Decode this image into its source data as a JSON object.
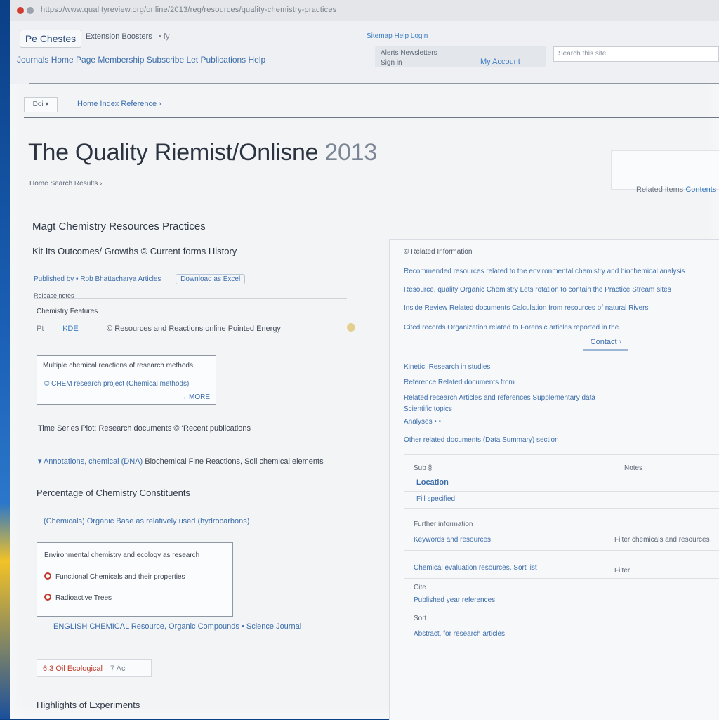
{
  "browser": {
    "url_text": "https://www.qualityreview.org/online/2013/reg/resources/quality-chemistry-practices"
  },
  "header": {
    "logo": "Pe Chestes",
    "link_a": "Extension Boosters",
    "link_b": "• fy",
    "top_right": "Sitemap Help Login",
    "nav": "Journals Home Page Membership  Subscribe  Let Publications Help",
    "mid_1": "Alerts Newsletters",
    "mid_2": "Sign in",
    "mid_3": "My Account",
    "search_placeholder": "Search this site"
  },
  "breadcrumb": {
    "box": "Doi ▾",
    "link": "Home Index Reference ›"
  },
  "page": {
    "title": "The Quality Riemist/Onlisne",
    "title_year": "2013",
    "subtitle": "Home Search Results ›"
  },
  "right_card": {
    "text": "Related items",
    "blue": "Contents"
  },
  "left": {
    "h2": "Magt Chemistry Resources Practices",
    "h3": "Kit Its Outcomes/ Growths  © Current forms History",
    "meta": "Published by • Rob Bhattacharya Articles",
    "meta_red": "Articles",
    "meta_pill": "Download as Excel",
    "small_label": "Release notes",
    "small_label2": "Chemistry Features",
    "row_tag": "Pt",
    "row_blue": "KDE",
    "row_text": "©  Resources and Reactions online Pointed Energy",
    "box_a": {
      "t1": "Multiple chemical reactions of research methods",
      "t2": "© CHEM  research project (Chemical methods)",
      "t3": "→ MORE"
    },
    "para_1": "Time Series Plot: Research documents © ‘Recent publications",
    "para_2_blue": "▾ Annotations, chemical (DNA)",
    "para_2": " Biochemical Fine Reactions, Soil chemical elements",
    "h3b": "Percentage of Chemistry Constituents",
    "link": "(Chemicals)  Organic Base as relatively used (hydrocarbons)",
    "box_b": {
      "t1": "Environmental chemistry and ecology as research",
      "t2": "Functional Chemicals and their properties",
      "t3": "Radioactive Trees"
    },
    "link2": "ENGLISH CHEMICAL Resource, Organic Compounds • Science Journal",
    "pill_red": "6.3 Oil Ecological",
    "pill_grey": "7 Ac",
    "foot": "Highlights of Experiments"
  },
  "right_panel": {
    "head": "© Related Information",
    "rows": [
      "Recommended resources related to the environmental chemistry and biochemical analysis",
      "Resource, quality   Organic Chemistry   Lets rotation to contain the Practice Stream sites",
      "Inside Review   Related documents   Calculation from resources of natural Rivers",
      "Cited records   Organization   related to   Forensic articles reported in the",
      "Kinetic, Research   in studies",
      "Reference   Related documents from",
      "Related research   Articles and references   Supplementary data",
      "Scientific topics",
      "Analyses   •   •"
    ],
    "btn": "Contact ›",
    "link_row": "Other related documents (Data Summary) section",
    "f1": "Sub §",
    "f1r": "Notes",
    "f2": "Location",
    "f3": "Fill specified",
    "f4": "Further information",
    "f5": "Keywords and resources",
    "f5r": "Filter chemicals and resources",
    "f6": "Chemical evaluation resources, Sort list",
    "f6r": "Filter",
    "f7": "Cite",
    "f8": "Published year references",
    "f9": "Sort",
    "f10": "Abstract, for research articles"
  }
}
